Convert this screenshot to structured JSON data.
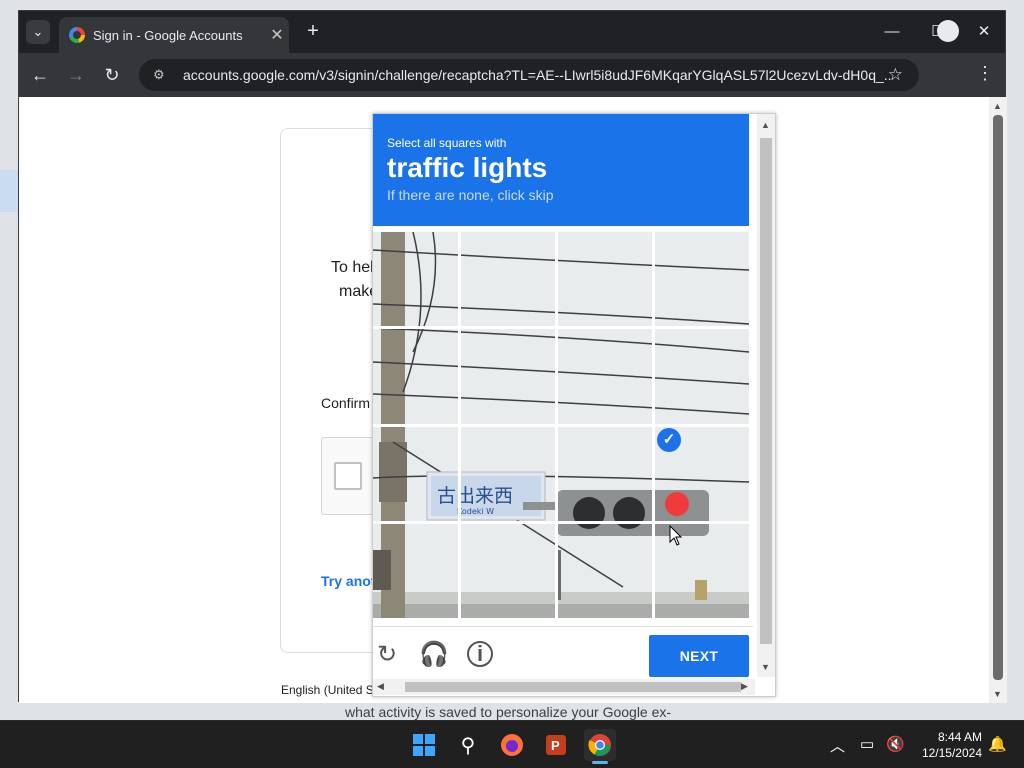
{
  "browser": {
    "tab_title": "Sign in - Google Accounts",
    "tab_close": "✕",
    "new_tab": "+",
    "url": "accounts.google.com/v3/signin/challenge/recaptcha?TL=AE--LIwrl5i8udJF6MKqarYGlqASL57l2UcezvLdv-dH0q_...",
    "minimize": "—",
    "maximize": "☐",
    "close": "✕"
  },
  "signin_card": {
    "line1": "To hel",
    "line2": "make",
    "confirm": "Confirm",
    "try_another": "Try anot",
    "language": "English (United S"
  },
  "background": {
    "page_text": "what activity is saved to personalize your Google ex-"
  },
  "captcha": {
    "instruction_small": "Select all squares with",
    "target": "traffic lights",
    "hint": "If there are none, click skip",
    "next_label": "NEXT",
    "sign_text": "古出来西",
    "sign_sub": "Kodeki W",
    "selected_tiles": [
      "row 3, col 4"
    ]
  },
  "taskbar": {
    "time": "8:44 AM",
    "date": "12/15/2024"
  },
  "colors": {
    "captcha_blue": "#1a73e8",
    "chrome_dark": "#202124",
    "taskbar": "#202020"
  }
}
